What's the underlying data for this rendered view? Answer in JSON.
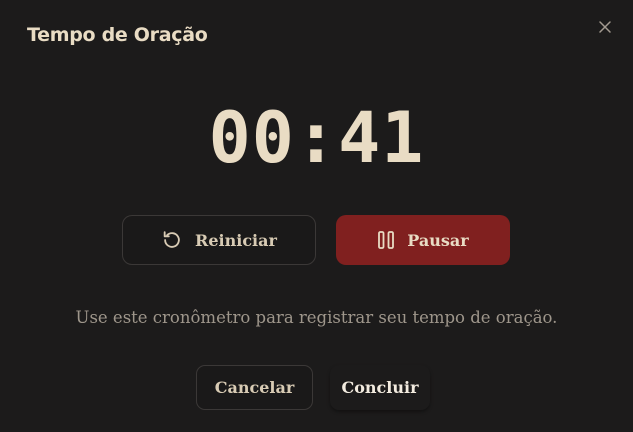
{
  "dialog": {
    "title": "Tempo de Oração",
    "close_icon": "close-icon"
  },
  "timer": {
    "display": "00:41"
  },
  "controls": {
    "reset_label": "Reiniciar",
    "reset_icon": "restart-icon",
    "pause_label": "Pausar",
    "pause_icon": "pause-icon"
  },
  "instructions": "Use este cronômetro para registrar seu tempo de oração.",
  "footer": {
    "cancel_label": "Cancelar",
    "finish_label": "Concluir"
  },
  "colors": {
    "background": "#1c1b1b",
    "text": "#e9dcc4",
    "muted_text": "#9e968b",
    "primary": "#80201f",
    "border": "#3b3837"
  }
}
